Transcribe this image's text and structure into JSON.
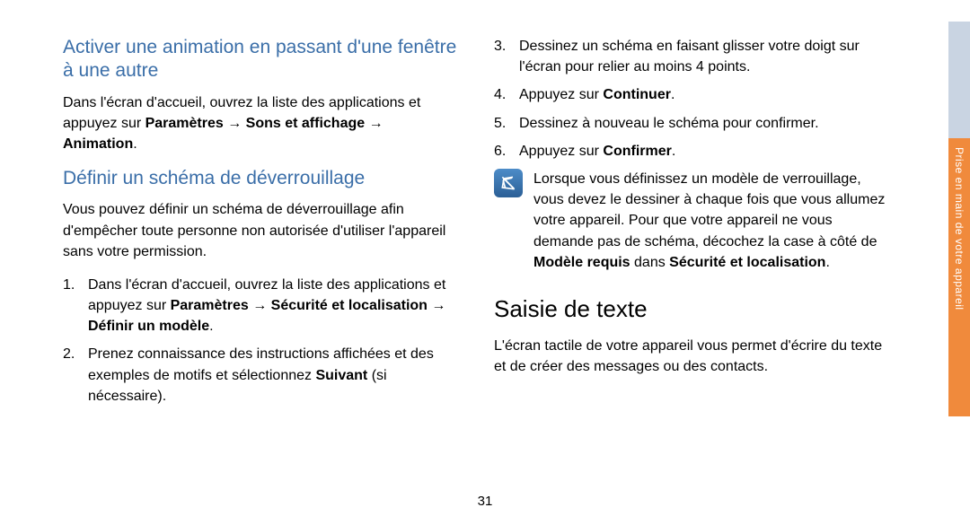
{
  "left": {
    "heading1": "Activer une animation en passant d'une fenêtre à une autre",
    "para1_pre": "Dans l'écran d'accueil, ouvrez la liste des applications et appuyez sur ",
    "para1_b1": "Paramètres",
    "arrow": " → ",
    "para1_b2": "Sons et affichage",
    "para1_b3": "Animation",
    "para1_end": ".",
    "heading2": "Définir un schéma de déverrouillage",
    "para2": "Vous pouvez définir un schéma de déverrouillage afin d'empêcher toute personne non autorisée d'utiliser l'appareil sans votre permission.",
    "li1_pre": "Dans l'écran d'accueil, ouvrez la liste des applications et appuyez sur ",
    "li1_b1": "Paramètres",
    "li1_b2": "Sécurité et localisation",
    "li1_b3": "Définir un modèle",
    "li1_end": ".",
    "li2_pre": "Prenez connaissance des instructions affichées et des exemples de motifs et sélectionnez ",
    "li2_b1": "Suivant",
    "li2_post": " (si nécessaire)."
  },
  "right": {
    "li3": "Dessinez un schéma en faisant glisser votre doigt sur l'écran pour relier au moins 4 points.",
    "li4_pre": "Appuyez sur ",
    "li4_b": "Continuer",
    "li4_end": ".",
    "li5": "Dessinez à nouveau le schéma pour confirmer.",
    "li6_pre": "Appuyez sur ",
    "li6_b": "Confirmer",
    "li6_end": ".",
    "note_pre": "Lorsque vous définissez un modèle de verrouillage, vous devez le dessiner à chaque fois que vous allumez votre appareil. Pour que votre appareil ne vous demande pas de schéma, décochez la case à côté de ",
    "note_b1": "Modèle requis",
    "note_mid": " dans ",
    "note_b2": "Sécurité et localisation",
    "note_end": ".",
    "heading3": "Saisie de texte",
    "para3": "L'écran tactile de votre appareil vous permet d'écrire du texte et de créer des messages ou des contacts."
  },
  "sideTab": "Prise en main de votre appareil",
  "pageNumber": "31"
}
